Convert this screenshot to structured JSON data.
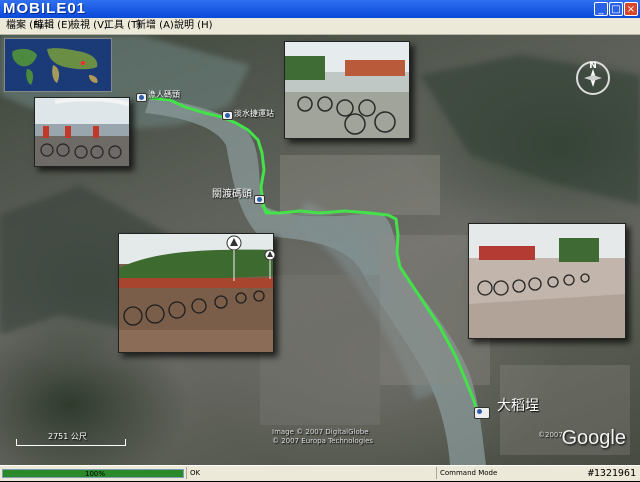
{
  "window": {
    "logo": "MOBILE01",
    "minimize_glyph": "_",
    "maximize_glyph": "□",
    "close_glyph": "×"
  },
  "menu": {
    "items": [
      "檔案 (F)",
      "編輯 (E)",
      "檢視 (V)",
      "工具 (T)",
      "新增 (A)",
      "說明 (H)"
    ]
  },
  "map": {
    "places": [
      {
        "name": "漁人碼頭"
      },
      {
        "name": "淡水捷運站"
      },
      {
        "name": "關渡碼頭"
      },
      {
        "name": "大稻埕"
      }
    ],
    "compass_label": "N",
    "scale_label": "2751 公尺",
    "copyright_lines": [
      "Image © 2007 DigitalGlobe",
      "© 2007 Europa Technologies"
    ],
    "google_logo": "Google",
    "google_year": "©2007"
  },
  "statusbar": {
    "progress_percent": 100,
    "progress_text": "100%",
    "status_text": "OK",
    "mode_text": "Command Mode",
    "watermark": "#1321961"
  },
  "colors": {
    "route": "#44e24a",
    "titlebar": "#0b49d8",
    "progress": "#2a8a2a"
  },
  "icons": [
    "camera-icon",
    "compass-icon",
    "close-icon",
    "minimize-icon",
    "maximize-icon"
  ]
}
